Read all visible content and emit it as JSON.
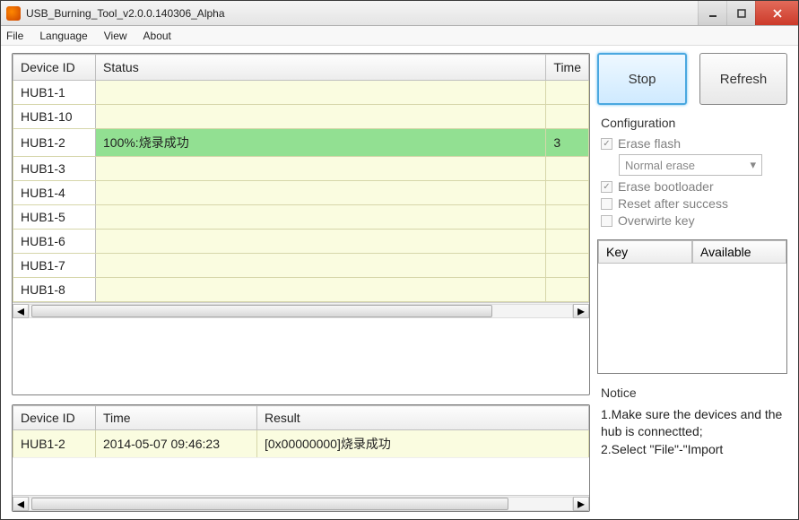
{
  "window": {
    "title": "USB_Burning_Tool_v2.0.0.140306_Alpha"
  },
  "menu": {
    "file": "File",
    "language": "Language",
    "view": "View",
    "about": "About"
  },
  "grid": {
    "headers": {
      "device": "Device ID",
      "status": "Status",
      "time": "Time"
    },
    "rows": [
      {
        "id": "HUB1-1",
        "status": "",
        "time": ""
      },
      {
        "id": "HUB1-10",
        "status": "",
        "time": ""
      },
      {
        "id": "HUB1-2",
        "status": "100%:烧录成功",
        "time": "3",
        "success": true
      },
      {
        "id": "HUB1-3",
        "status": "",
        "time": ""
      },
      {
        "id": "HUB1-4",
        "status": "",
        "time": ""
      },
      {
        "id": "HUB1-5",
        "status": "",
        "time": ""
      },
      {
        "id": "HUB1-6",
        "status": "",
        "time": ""
      },
      {
        "id": "HUB1-7",
        "status": "",
        "time": ""
      },
      {
        "id": "HUB1-8",
        "status": "",
        "time": ""
      }
    ]
  },
  "log": {
    "headers": {
      "device": "Device ID",
      "time": "Time",
      "result": "Result"
    },
    "rows": [
      {
        "id": "HUB1-2",
        "time": "2014-05-07 09:46:23",
        "result": "[0x00000000]烧录成功"
      }
    ]
  },
  "buttons": {
    "stop": "Stop",
    "refresh": "Refresh"
  },
  "config": {
    "title": "Configuration",
    "erase_flash": "Erase flash",
    "erase_mode": "Normal erase",
    "erase_bootloader": "Erase bootloader",
    "reset_after": "Reset after success",
    "overwrite_key": "Overwirte key"
  },
  "keypanel": {
    "key": "Key",
    "available": "Available"
  },
  "notice": {
    "title": "Notice",
    "line1": "1.Make sure the devices and the hub is connectted;",
    "line2": "2.Select \"File\"-\"Import"
  }
}
